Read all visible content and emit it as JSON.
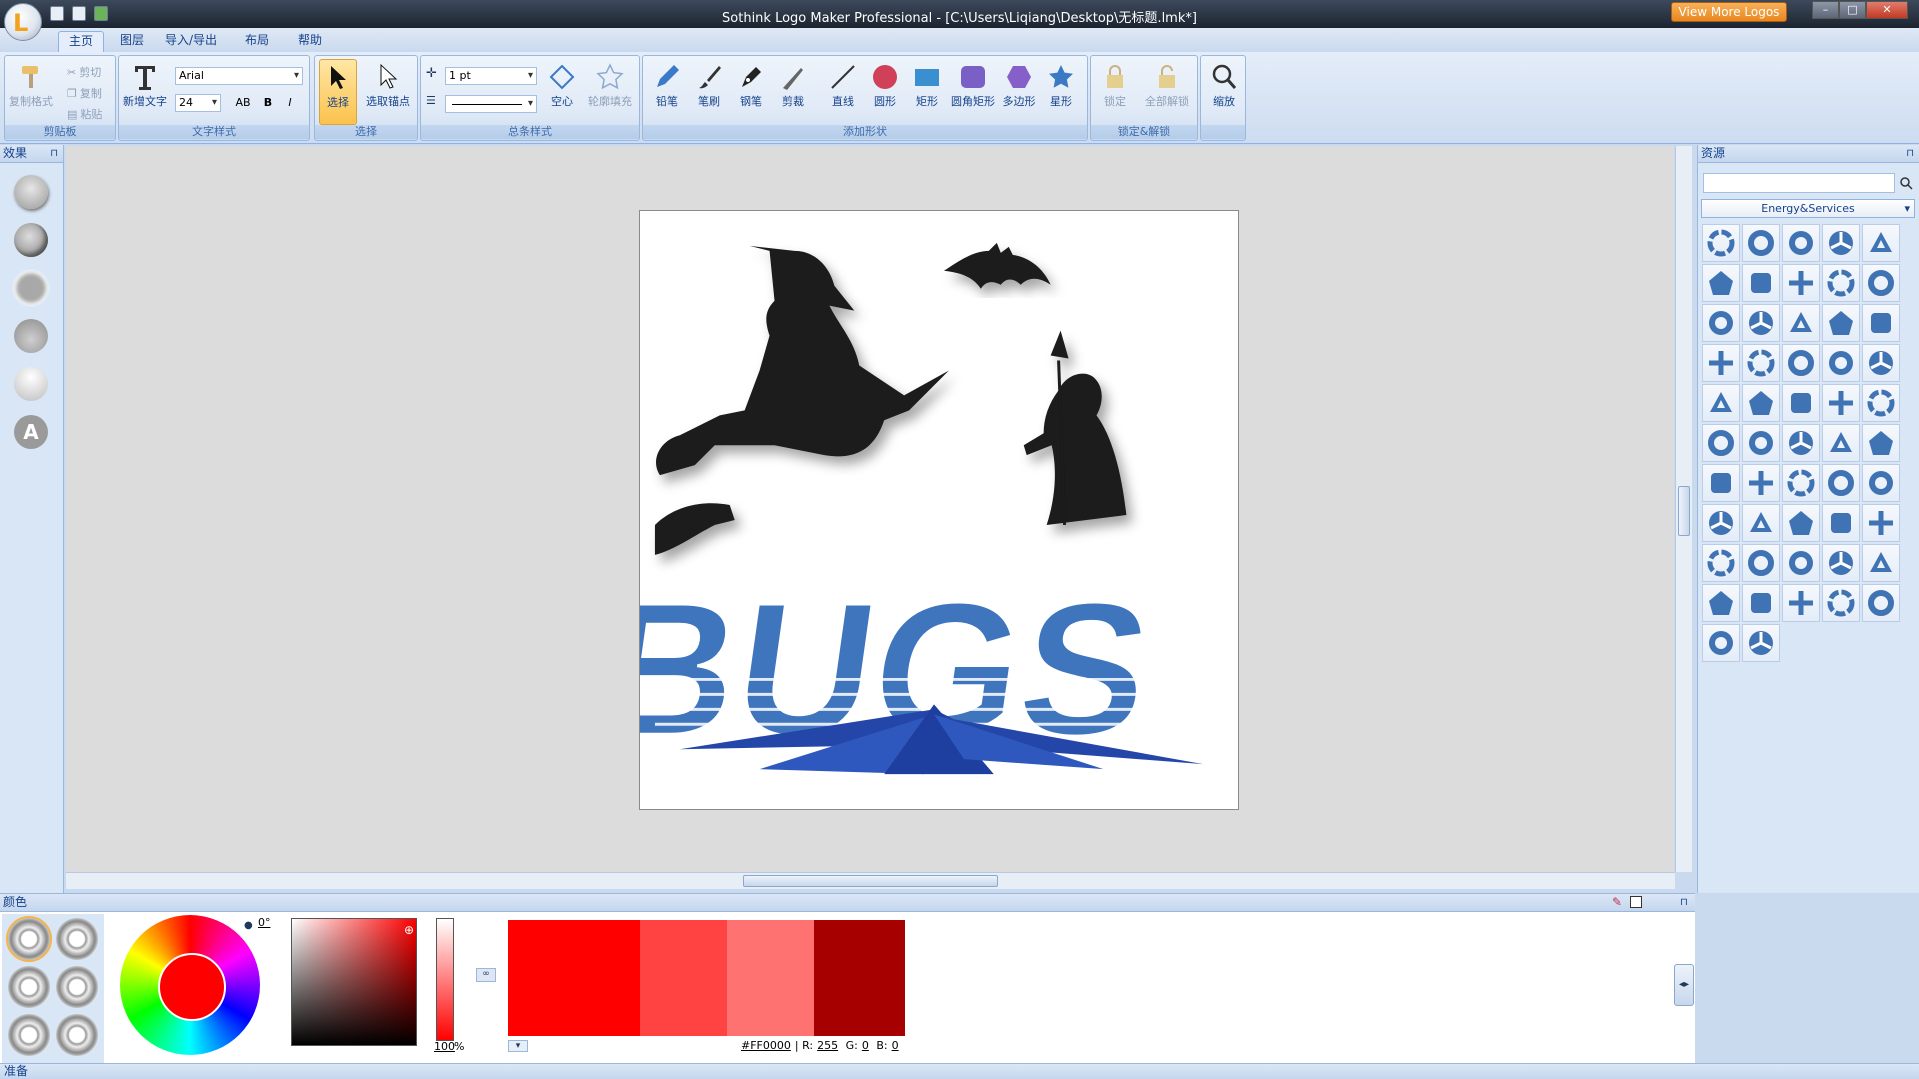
{
  "window": {
    "title": "Sothink Logo Maker Professional - [C:\\Users\\Liqiang\\Desktop\\无标题.lmk*]",
    "view_more": "View More Logos",
    "min": "–",
    "max": "□",
    "close": "✕"
  },
  "tabs": [
    "主页",
    "图层",
    "导入/导出",
    "布局",
    "帮助"
  ],
  "ribbon": {
    "clipboard": {
      "caption": "剪贴板",
      "format_painter": "复制格式",
      "cut": "剪切",
      "copy": "复制",
      "paste": "粘贴"
    },
    "text": {
      "caption": "文字样式",
      "new_text": "新增文字",
      "font": "Arial",
      "size": "24",
      "ab": "AB",
      "bold": "B",
      "italic": "I"
    },
    "select": {
      "caption": "选择",
      "select": "选择",
      "select_anchor": "选取锚点"
    },
    "stroke": {
      "caption": "总条样式",
      "width": "1 pt",
      "hollow": "空心",
      "outline_fill": "轮廓填充"
    },
    "shapes": {
      "caption": "添加形状",
      "pencil": "铅笔",
      "brush": "笔刷",
      "pen": "钢笔",
      "cut": "剪裁",
      "line": "直线",
      "circle": "圆形",
      "rect": "矩形",
      "round_rect": "圆角矩形",
      "polygon": "多边形",
      "star": "星形"
    },
    "lock": {
      "caption": "锁定&解锁",
      "lock": "锁定",
      "unlock_all": "全部解锁"
    },
    "zoom": {
      "caption": "",
      "zoom": "缩放"
    }
  },
  "left_panel": {
    "title": "效果",
    "pin": "⊓"
  },
  "resources": {
    "title": "资源",
    "pin": "⊓",
    "category": "Energy&Services",
    "count": 52
  },
  "artwork": {
    "logo_text": "BUGS",
    "text_color": "#3f75bd",
    "base_color": "#2346a8",
    "silhouette_color": "#1a1a1a"
  },
  "color": {
    "title": "颜色",
    "angle": "0°",
    "alpha": "100",
    "alpha_unit": "%",
    "hex": "#FF0000",
    "r_label": "R:",
    "r": "255",
    "g_label": "G:",
    "g": "0",
    "b_label": "B:",
    "b": "0",
    "swatches": [
      "#ff0000",
      "#ff4242",
      "#ff7272",
      "#a60000"
    ]
  },
  "status": {
    "text": "准备"
  }
}
